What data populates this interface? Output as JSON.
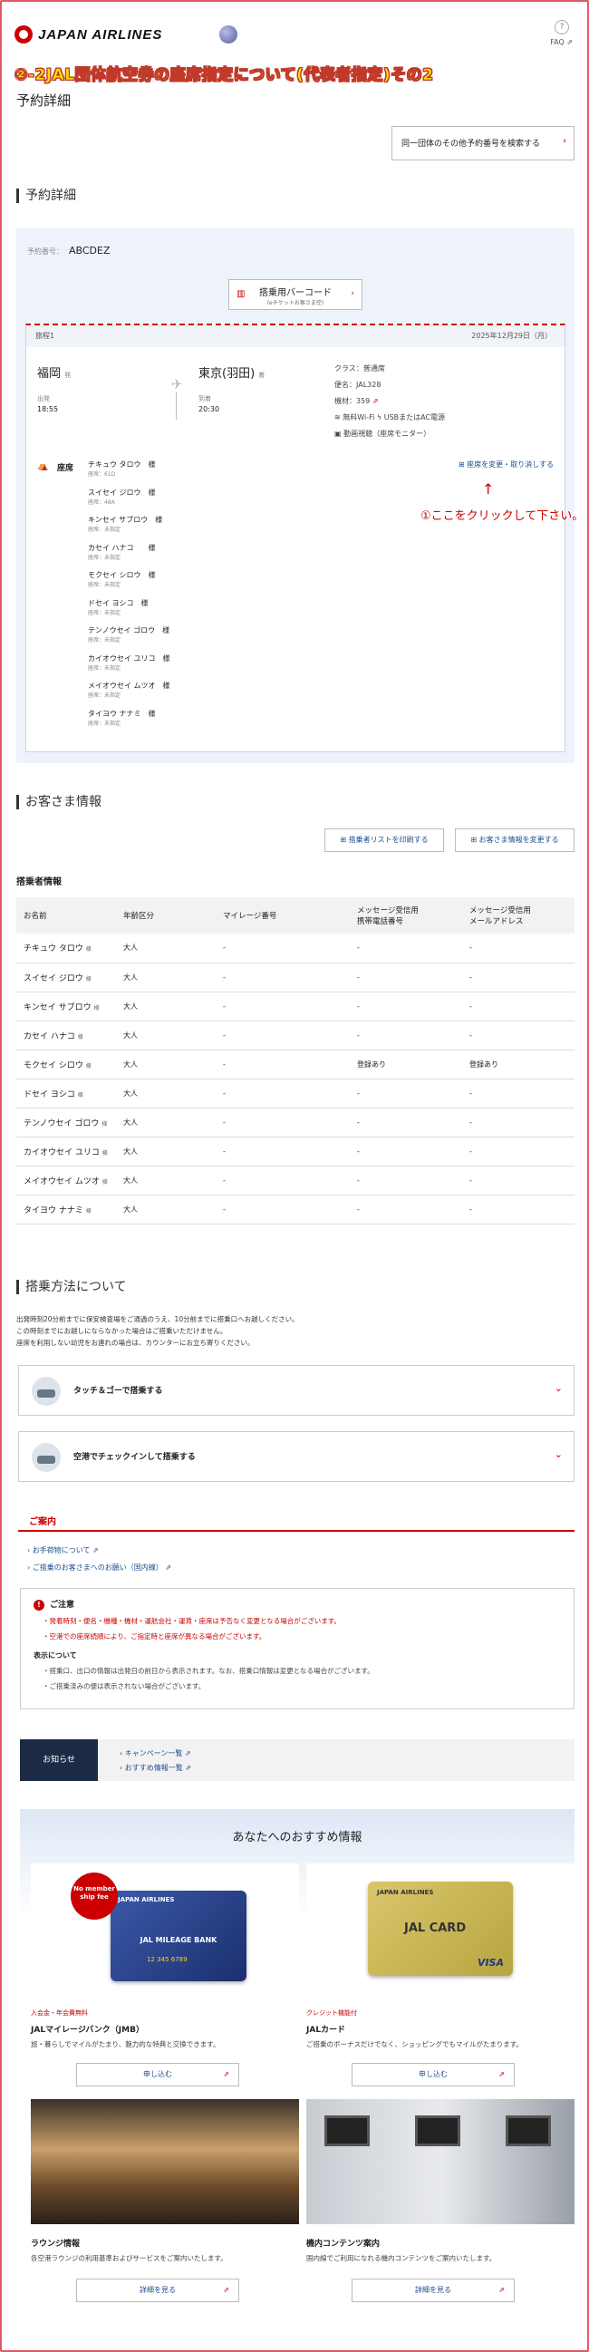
{
  "header": {
    "brand": "JAPAN AIRLINES",
    "faq_icon": "?",
    "faq_label": "FAQ ⇗"
  },
  "annotation": {
    "headline": "②-2JAL団体航空券の座席指定について(代表者指定)その2",
    "click_note": "①ここをクリックして下さい。",
    "arrow": "↑"
  },
  "page_title": "予約詳細",
  "search_other_button": "同一団体のその他予約番号を検索する",
  "reservation": {
    "section_title": "予約詳細",
    "number_label": "予約番号：",
    "number": "ABCDEZ",
    "barcode_label": "搭乗用バーコード",
    "barcode_sub": "(eチケットお客さま控)",
    "trip_label": "旅程1",
    "date": "2025年12月29日（月）",
    "from": "福岡",
    "from_suffix": "発",
    "dep_label": "出発",
    "dep_time": "18:55",
    "to": "東京(羽田)",
    "to_suffix": "着",
    "arr_label": "到着",
    "arr_time": "20:30",
    "class": "クラス：普通席",
    "flight": "便名：JAL328",
    "aircraft": "機材：359",
    "wifi": "無料Wi-Fi",
    "power": "USBまたはAC電源",
    "video": "動画視聴（座席モニター）",
    "seat_label": "座席",
    "seat_change_link": "座席を変更・取り消しする",
    "passengers": [
      {
        "name": "チキュウ タロウ　様",
        "seat": "座席：61D"
      },
      {
        "name": "スイセイ ジロウ　様",
        "seat": "座席：48A"
      },
      {
        "name": "キンセイ サブロウ　様",
        "seat": "座席：未指定"
      },
      {
        "name": "カセイ ハナコ　　様",
        "seat": "座席：未指定"
      },
      {
        "name": "モクセイ シロウ　様",
        "seat": "座席：未指定"
      },
      {
        "name": "ドセイ ヨシコ　様",
        "seat": "座席：未指定"
      },
      {
        "name": "テンノウセイ ゴロウ　様",
        "seat": "座席：未指定"
      },
      {
        "name": "カイオウセイ ユリコ　様",
        "seat": "座席：未指定"
      },
      {
        "name": "メイオウセイ ムツオ　様",
        "seat": "座席：未指定"
      },
      {
        "name": "タイヨウ ナナミ　様",
        "seat": "座席：未指定"
      }
    ]
  },
  "customer": {
    "section_title": "お客さま情報",
    "print_button": "搭乗者リストを印刷する",
    "change_button": "お客さま情報を変更する",
    "table_title": "搭乗者情報",
    "headers": [
      "お名前",
      "年齢区分",
      "マイレージ番号",
      "メッセージ受信用\n携帯電話番号",
      "メッセージ受信用\nメールアドレス"
    ],
    "rows": [
      [
        "チキュウ タロウ",
        "大人",
        "-",
        "-",
        "-"
      ],
      [
        "スイセイ ジロウ",
        "大人",
        "-",
        "-",
        "-"
      ],
      [
        "キンセイ サブロウ",
        "大人",
        "-",
        "-",
        "-"
      ],
      [
        "カセイ ハナコ",
        "大人",
        "-",
        "-",
        "-"
      ],
      [
        "モクセイ シロウ",
        "大人",
        "-",
        "登録あり",
        "登録あり"
      ],
      [
        "ドセイ ヨシコ",
        "大人",
        "-",
        "-",
        "-"
      ],
      [
        "テンノウセイ ゴロウ",
        "大人",
        "-",
        "-",
        "-"
      ],
      [
        "カイオウセイ ユリコ",
        "大人",
        "-",
        "-",
        "-"
      ],
      [
        "メイオウセイ ムツオ",
        "大人",
        "-",
        "-",
        "-"
      ],
      [
        "タイヨウ ナナミ",
        "大人",
        "-",
        "-",
        "-"
      ]
    ],
    "honorific": "様"
  },
  "boarding": {
    "section_title": "搭乗方法について",
    "text1": "出発時刻20分前までに保安検査場をご通過のうえ、10分前までに搭乗口へお越しください。",
    "text2": "この時刻までにお越しにならなかった場合はご搭乗いただけません。",
    "text3": "座席を利用しない幼児をお連れの場合は、カウンターにお立ち寄りください。",
    "option1": "タッチ＆ゴーで搭乗する",
    "option2": "空港でチェックインして搭乗する"
  },
  "guide": {
    "title": "ご案内",
    "link1": "お手荷物について ⇗",
    "link2": "ご搭乗のお客さまへのお願い（国内線） ⇗",
    "caution_title": "ご注意",
    "caution1": "・発着時刻・便名・機種・機材・運航会社・運賃・座席は予告なく変更となる場合がございます。",
    "caution2": "・空港での座席続順により、ご指定時と座席が異なる場合がございます。",
    "display_title": "表示について",
    "display1": "・搭乗口、出口の情報は出発日の前日から表示されます。なお、搭乗口情報は変更となる場合がございます。",
    "display2": "・ご搭乗済みの便は表示されない場合がございます。"
  },
  "news": {
    "label": "お知らせ",
    "link1": "キャンペーン一覧 ⇗",
    "link2": "おすすめ情報一覧 ⇗"
  },
  "recommend": {
    "title": "あなたへのおすすめ情報",
    "card1": {
      "badge": "No member ship fee",
      "card_brand": "JAPAN AIRLINES",
      "card_text": "JAL MILEAGE BANK",
      "card_number": "12 345 6789",
      "tag": "入会金・年会費無料",
      "name": "JALマイレージバンク（JMB）",
      "desc": "旅・暮らしでマイルがたまり、魅力的な特典と交換できます。",
      "button": "申し込む"
    },
    "card2": {
      "card_brand": "JAPAN AIRLINES",
      "card_text": "JAL CARD",
      "card_mark": "VISA",
      "tag": "クレジット機能付",
      "name": "JALカード",
      "desc": "ご搭乗のボーナスだけでなく、ショッピングでもマイルがたまります。",
      "button": "申し込む"
    },
    "card3": {
      "name": "ラウンジ情報",
      "desc": "各空港ラウンジの利用基準およびサービスをご案内いたします。",
      "button": "詳細を見る"
    },
    "card4": {
      "name": "機内コンテンツ案内",
      "desc": "国内線でご利用になれる機内コンテンツをご案内いたします。",
      "button": "詳細を見る"
    }
  }
}
